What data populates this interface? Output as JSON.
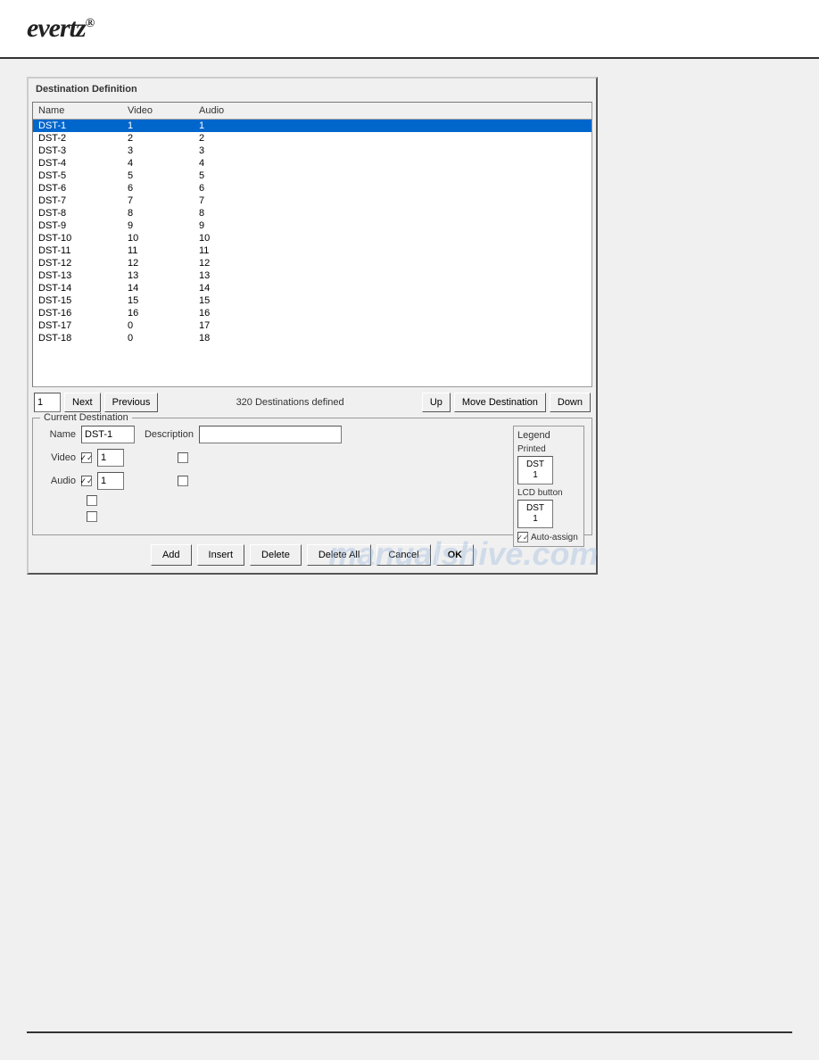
{
  "header": {
    "logo": "evertz",
    "logo_suffix": "®"
  },
  "dialog": {
    "title": "Destination Definition",
    "columns": {
      "name": "Name",
      "video": "Video",
      "audio": "Audio"
    },
    "rows": [
      {
        "name": "DST-1",
        "video": "1",
        "audio": "1",
        "selected": true
      },
      {
        "name": "DST-2",
        "video": "2",
        "audio": "2"
      },
      {
        "name": "DST-3",
        "video": "3",
        "audio": "3"
      },
      {
        "name": "DST-4",
        "video": "4",
        "audio": "4"
      },
      {
        "name": "DST-5",
        "video": "5",
        "audio": "5"
      },
      {
        "name": "DST-6",
        "video": "6",
        "audio": "6"
      },
      {
        "name": "DST-7",
        "video": "7",
        "audio": "7"
      },
      {
        "name": "DST-8",
        "video": "8",
        "audio": "8"
      },
      {
        "name": "DST-9",
        "video": "9",
        "audio": "9"
      },
      {
        "name": "DST-10",
        "video": "10",
        "audio": "10"
      },
      {
        "name": "DST-11",
        "video": "11",
        "audio": "11"
      },
      {
        "name": "DST-12",
        "video": "12",
        "audio": "12"
      },
      {
        "name": "DST-13",
        "video": "13",
        "audio": "13"
      },
      {
        "name": "DST-14",
        "video": "14",
        "audio": "14"
      },
      {
        "name": "DST-15",
        "video": "15",
        "audio": "15"
      },
      {
        "name": "DST-16",
        "video": "16",
        "audio": "16"
      },
      {
        "name": "DST-17",
        "video": "0",
        "audio": "17"
      },
      {
        "name": "DST-18",
        "video": "0",
        "audio": "18"
      }
    ],
    "nav": {
      "input_value": "1",
      "next_label": "Next",
      "previous_label": "Previous",
      "status": "320 Destinations defined",
      "up_label": "Up",
      "move_label": "Move Destination",
      "down_label": "Down"
    },
    "current_dest": {
      "section_label": "Current Destination",
      "name_label": "Name",
      "name_value": "DST-1",
      "desc_label": "Description",
      "desc_value": "",
      "video_label": "Video",
      "video_checked": true,
      "video_value": "1",
      "audio_label": "Audio",
      "audio_checked": true,
      "audio_value": "1"
    },
    "legend": {
      "label": "Legend",
      "printed_label": "Printed",
      "printed_dst_line1": "DST",
      "printed_dst_line2": "1",
      "lcd_label": "LCD button",
      "lcd_dst_line1": "DST",
      "lcd_dst_line2": "1",
      "auto_assign_label": "Auto-assign",
      "auto_assign_checked": true
    },
    "buttons": {
      "add": "Add",
      "insert": "Insert",
      "delete": "Delete",
      "delete_all": "Delete All",
      "cancel": "Cancel",
      "ok": "OK"
    }
  },
  "watermark": "manualshive.com"
}
